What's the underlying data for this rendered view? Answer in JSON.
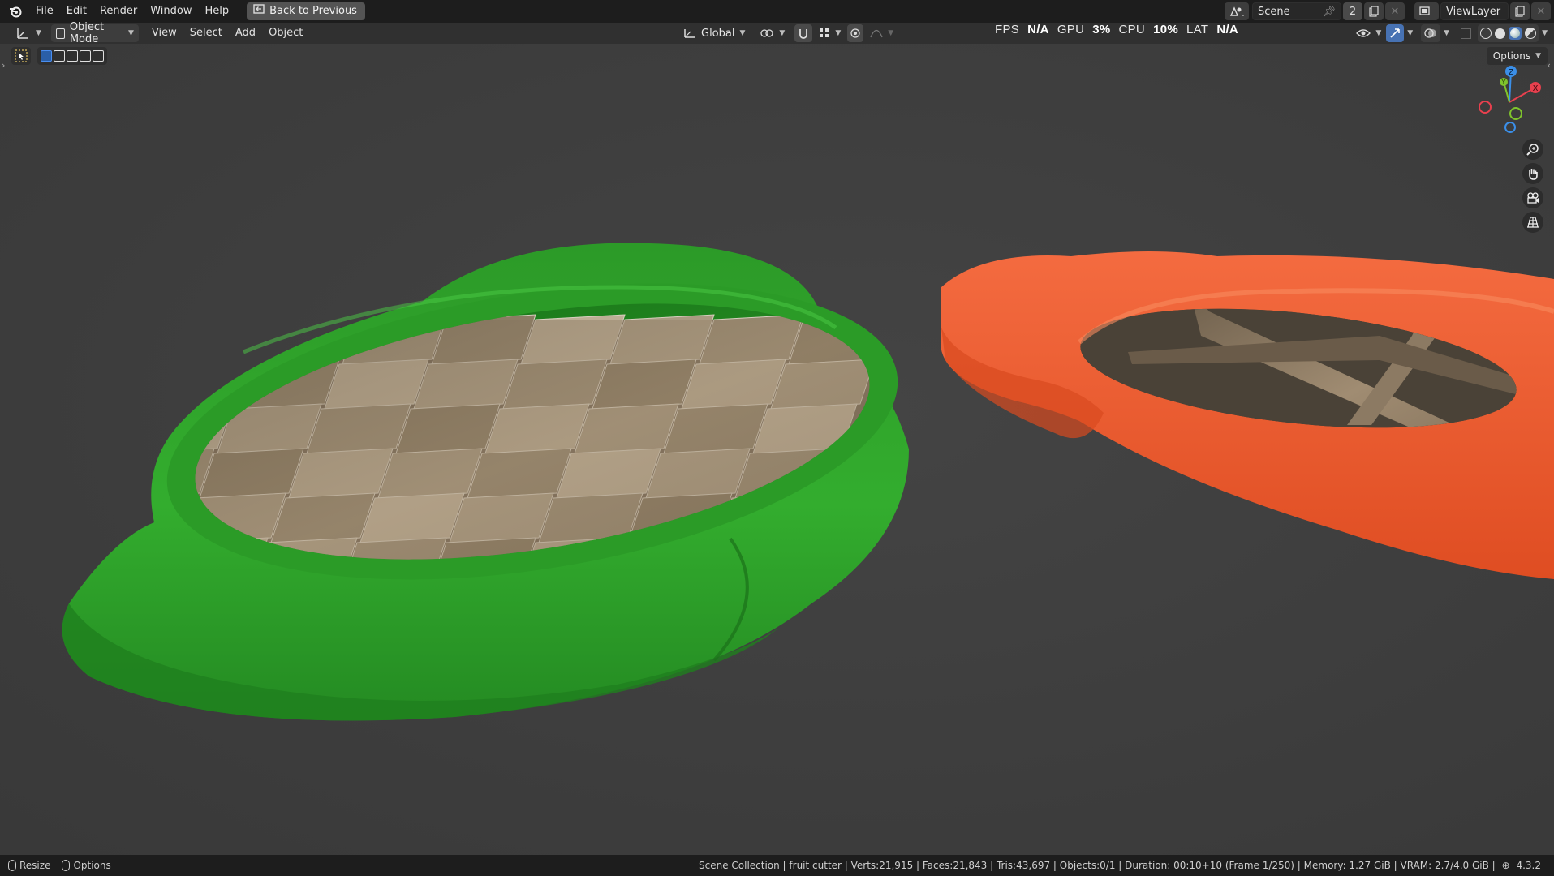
{
  "menu": {
    "items": [
      "File",
      "Edit",
      "Render",
      "Window",
      "Help"
    ],
    "back_button": "Back to Previous"
  },
  "scene": {
    "name": "Scene",
    "users": "2",
    "view_layer": "ViewLayer"
  },
  "viewport_header": {
    "mode": "Object Mode",
    "menus": [
      "View",
      "Select",
      "Add",
      "Object"
    ],
    "orientation": "Global",
    "options_label": "Options"
  },
  "overlay_stats": {
    "fps_label": "FPS",
    "fps_value": "N/A",
    "gpu_label": "GPU",
    "gpu_value": "3%",
    "cpu_label": "CPU",
    "cpu_value": "10%",
    "lat_label": "LAT",
    "lat_value": "N/A"
  },
  "gizmo": {
    "axis_z": "Z",
    "axis_y": "Y",
    "axis_x": "X"
  },
  "statusbar": {
    "resize_label": "Resize",
    "options_label": "Options",
    "stats": "Scene Collection | fruit cutter | Verts:21,915 | Faces:21,843 | Tris:43,697 | Objects:0/1 | Duration: 00:10+10 (Frame 1/250) | Memory: 1.27 GiB | VRAM: 2.7/4.0 GiB |",
    "version": "4.3.2"
  },
  "colors": {
    "green_cutter": "#2fa12a",
    "orange_cutter": "#f0572d",
    "blade_surface": "#8c7a63",
    "viewport_bg": "#3d3d3d",
    "axis_x": "#e8404e",
    "axis_y": "#7fc32c",
    "axis_z": "#3b8fe8"
  },
  "icons": [
    "blender-logo-icon",
    "back-icon",
    "scene-icon",
    "pin-icon",
    "new-scene-icon",
    "view-layer-icon",
    "editor-type-icon",
    "mode-icon",
    "orientation-icon",
    "pivot-icon",
    "snap-icon",
    "proportional-icon",
    "visibility-icon",
    "gizmo-icon",
    "overlay-icon",
    "xray-icon",
    "wireframe-shading-icon",
    "solid-shading-icon",
    "material-shading-icon",
    "rendered-shading-icon",
    "zoom-icon",
    "pan-icon",
    "camera-icon",
    "grid-icon",
    "mouse-icon",
    "globe-icon"
  ]
}
